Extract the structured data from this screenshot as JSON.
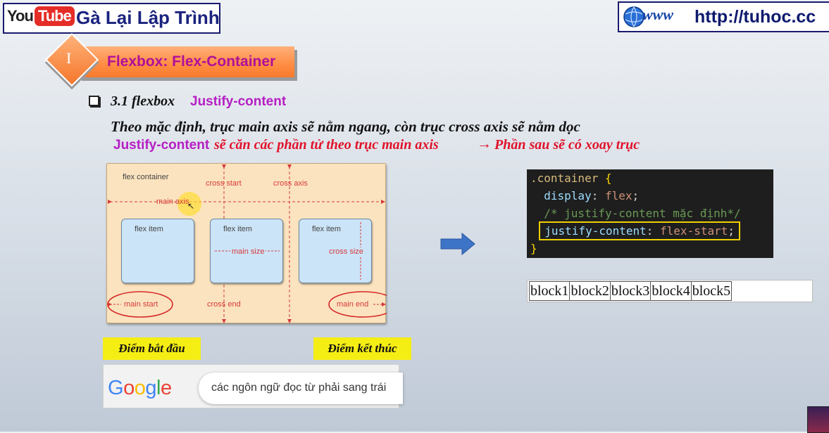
{
  "header": {
    "logo_you": "You",
    "logo_tube": "Tube",
    "channel_title": "Gà Lại Lập Trình",
    "url_logo_text": "www",
    "url": "http://tuhoc.cc"
  },
  "section": {
    "roman": "I",
    "title": "Flexbox: Flex-Container"
  },
  "subsection": {
    "number": "3.1 flexbox",
    "property": "Justify-content"
  },
  "description": {
    "line1": "Theo mặc định, trục main axis sẽ nằm ngang, còn trục cross axis sẽ nằm dọc",
    "line2_property": "Justify-content",
    "line2_text": "sẽ căn các phần tử theo trục main axis",
    "line2_arrow": "→",
    "line2_text2": "Phần sau sẽ có xoay trục"
  },
  "diagram": {
    "container_label": "flex container",
    "cross_start": "cross start",
    "cross_axis": "cross axis",
    "main_axis": "main axis",
    "item_label": "flex item",
    "main_size": "main size",
    "cross_size": "cross size",
    "main_start": "main start",
    "cross_end": "cross end",
    "main_end": "main end"
  },
  "code": {
    "line1_selector": ".container",
    "line1_brace": "{",
    "line2_prop": "display",
    "line2_val": "flex",
    "line3_comment": "/* justify-content mặc định*/",
    "line4_prop": "justify-content",
    "line4_val": "flex-start",
    "line5_brace": "}"
  },
  "output_blocks": [
    "block1",
    "block2",
    "block3",
    "block4",
    "block5"
  ],
  "labels": {
    "start_point": "Điểm bắt đầu",
    "end_point": "Điểm kết thúc"
  },
  "google": {
    "logo": "Google",
    "query": "các ngôn ngữ đọc từ phải sang trái"
  },
  "colors": {
    "accent_purple": "#b51ec4",
    "accent_red": "#e0122a",
    "banner_orange": "#ff8c42",
    "label_yellow": "#f5ee14"
  }
}
